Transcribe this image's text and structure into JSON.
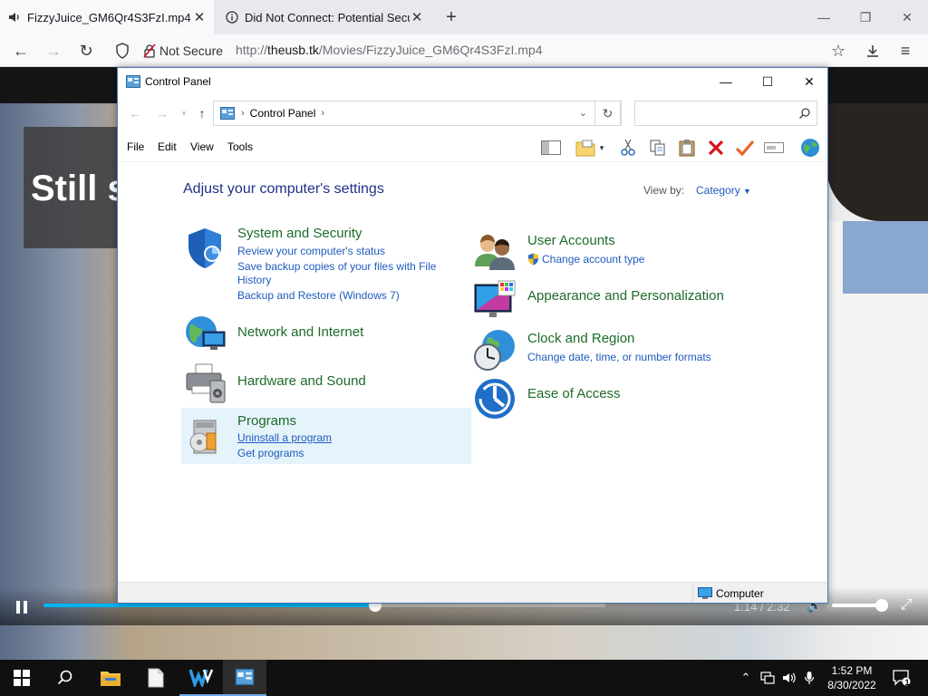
{
  "browser": {
    "tabs": [
      {
        "title": "FizzyJuice_GM6Qr4S3FzI.mp4",
        "active": true
      },
      {
        "title": "Did Not Connect: Potential Security Issue",
        "active": false
      }
    ],
    "security_label": "Not Secure",
    "url_prefix": "http://",
    "url_host": "theusb.tk",
    "url_path": "/Movies/FizzyJuice_GM6Qr4S3FzI.mp4"
  },
  "video": {
    "caption": "Still s",
    "time_current": "1:14",
    "time_total": "2:32",
    "progress": 0.59,
    "volume": 1.0
  },
  "control_panel": {
    "window_title": "Control Panel",
    "breadcrumb": "Control Panel",
    "search_placeholder": "",
    "menu": [
      "File",
      "Edit",
      "View",
      "Tools"
    ],
    "heading": "Adjust your computer's settings",
    "view_by_label": "View by:",
    "view_by_value": "Category",
    "categories_left": [
      {
        "title": "System and Security",
        "links": [
          "Review your computer's status",
          "Save backup copies of your files with File",
          "History",
          "Backup and Restore (Windows 7)"
        ],
        "icon": "shield-icon"
      },
      {
        "title": "Network and Internet",
        "links": [],
        "icon": "network-icon"
      },
      {
        "title": "Hardware and Sound",
        "links": [],
        "icon": "printer-icon"
      },
      {
        "title": "Programs",
        "links": [
          "Uninstall a program",
          "Get programs"
        ],
        "icon": "programs-icon"
      }
    ],
    "categories_right": [
      {
        "title": "User Accounts",
        "links": [
          "Change account type"
        ],
        "icon": "users-icon"
      },
      {
        "title": "Appearance and Personalization",
        "links": [],
        "icon": "appearance-icon"
      },
      {
        "title": "Clock and Region",
        "links": [
          "Change date, time, or number formats"
        ],
        "icon": "clock-icon"
      },
      {
        "title": "Ease of Access",
        "links": [],
        "icon": "ease-of-access-icon"
      }
    ],
    "status_computer": "Computer"
  },
  "taskbar": {
    "time": "1:52 PM",
    "date": "8/30/2022",
    "notification_count": "1"
  },
  "colors": {
    "accent_link": "#1e5bbd",
    "category_green": "#1e6b2a",
    "heading_blue": "#1e3287",
    "seek_blue": "#00b3f4"
  }
}
